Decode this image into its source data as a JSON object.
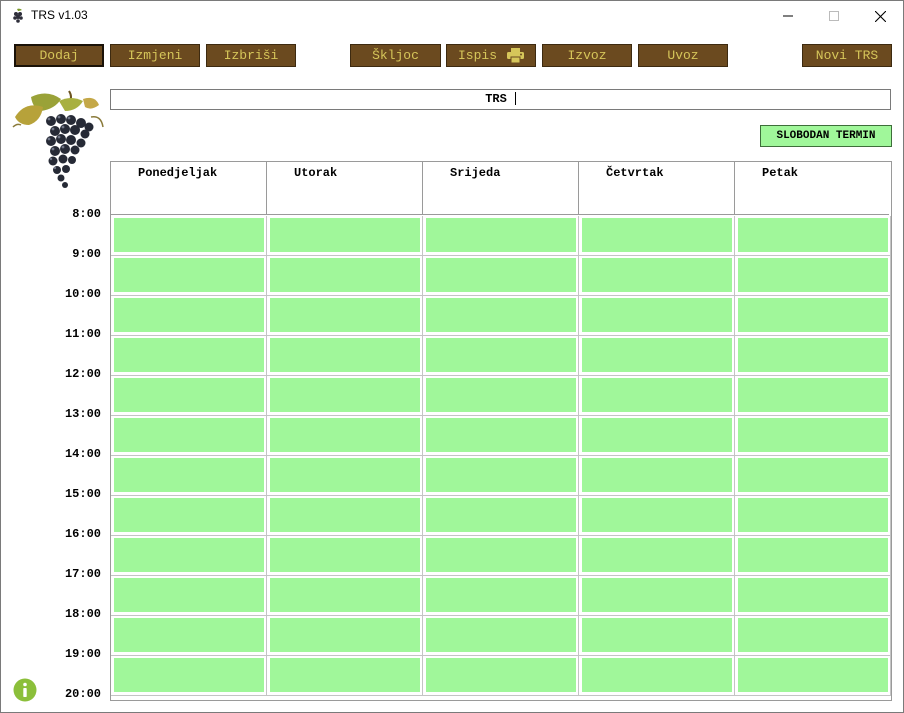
{
  "window": {
    "title": "TRS v1.03",
    "minimize_glyph": "—",
    "maximize_glyph": "☐",
    "close_glyph": "✕"
  },
  "toolbar": {
    "dodaj": "Dodaj",
    "izmjeni": "Izmjeni",
    "izbrisi": "Izbriši",
    "skljoc": "Škljoc",
    "ispis": "Ispis",
    "izvoz": "Izvoz",
    "uvoz": "Uvoz",
    "novi_trs": "Novi TRS"
  },
  "schedule": {
    "title": "TRS",
    "legend_label": "SLOBODAN TERMIN",
    "days": [
      "Ponedjeljak",
      "Utorak",
      "Srijeda",
      "Četvrtak",
      "Petak"
    ],
    "times": [
      "8:00",
      "9:00",
      "10:00",
      "11:00",
      "12:00",
      "13:00",
      "14:00",
      "15:00",
      "16:00",
      "17:00",
      "18:00",
      "19:00",
      "20:00"
    ],
    "slot_status": "free"
  },
  "colors": {
    "button_bg": "#6b4a1f",
    "button_text": "#d6c65a",
    "free_slot": "#a0f79a",
    "info_icon": "#8bbf3a"
  },
  "icons": {
    "app": "grape-icon",
    "print": "printer-icon",
    "info": "info-icon",
    "logo": "grapes-logo"
  }
}
